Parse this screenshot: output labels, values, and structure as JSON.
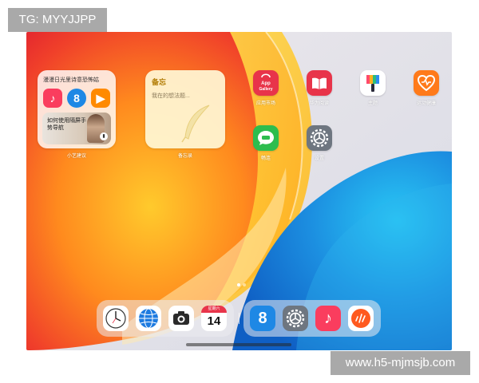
{
  "watermarks": {
    "top_left": "TG: MYYJJPP",
    "bottom_right": "www.h5-mjmsjb.com"
  },
  "widgets": {
    "suggestions": {
      "title": "漫漫日光里诗意恐怖姑",
      "promo_text": "如何使用隔屏手势导航",
      "label": "小艺建议",
      "mini_apps": [
        {
          "name": "music",
          "glyph": "♪",
          "color": "#fa3d5e"
        },
        {
          "name": "browser",
          "glyph": "8",
          "color": "#1e88e5"
        },
        {
          "name": "video",
          "glyph": "▶",
          "color": "#ff8a00"
        }
      ]
    },
    "notes": {
      "title": "备忘",
      "placeholder": "我在的想法题...",
      "label": "备忘录"
    }
  },
  "apps": [
    {
      "id": "app-gallery",
      "label": "应用市场",
      "icon_text": "App Gallery",
      "color": "#e8344a"
    },
    {
      "id": "books",
      "label": "华为阅读",
      "color": "#e8344a"
    },
    {
      "id": "themes",
      "label": "主题",
      "color": "#ffffff"
    },
    {
      "id": "health",
      "label": "运动健康",
      "color": "#ff7a1a"
    },
    {
      "id": "messages",
      "label": "畅连",
      "color": "#2dbd4e"
    },
    {
      "id": "settings",
      "label": "设置",
      "color": "#6e7680"
    }
  ],
  "dock": {
    "left": [
      {
        "id": "clock"
      },
      {
        "id": "browser-globe"
      },
      {
        "id": "camera"
      },
      {
        "id": "calendar",
        "weekday": "星期六",
        "day": "14"
      }
    ],
    "right": [
      {
        "id": "browser-8",
        "glyph": "8"
      },
      {
        "id": "settings"
      },
      {
        "id": "music",
        "glyph": "♪"
      },
      {
        "id": "voice"
      }
    ]
  }
}
